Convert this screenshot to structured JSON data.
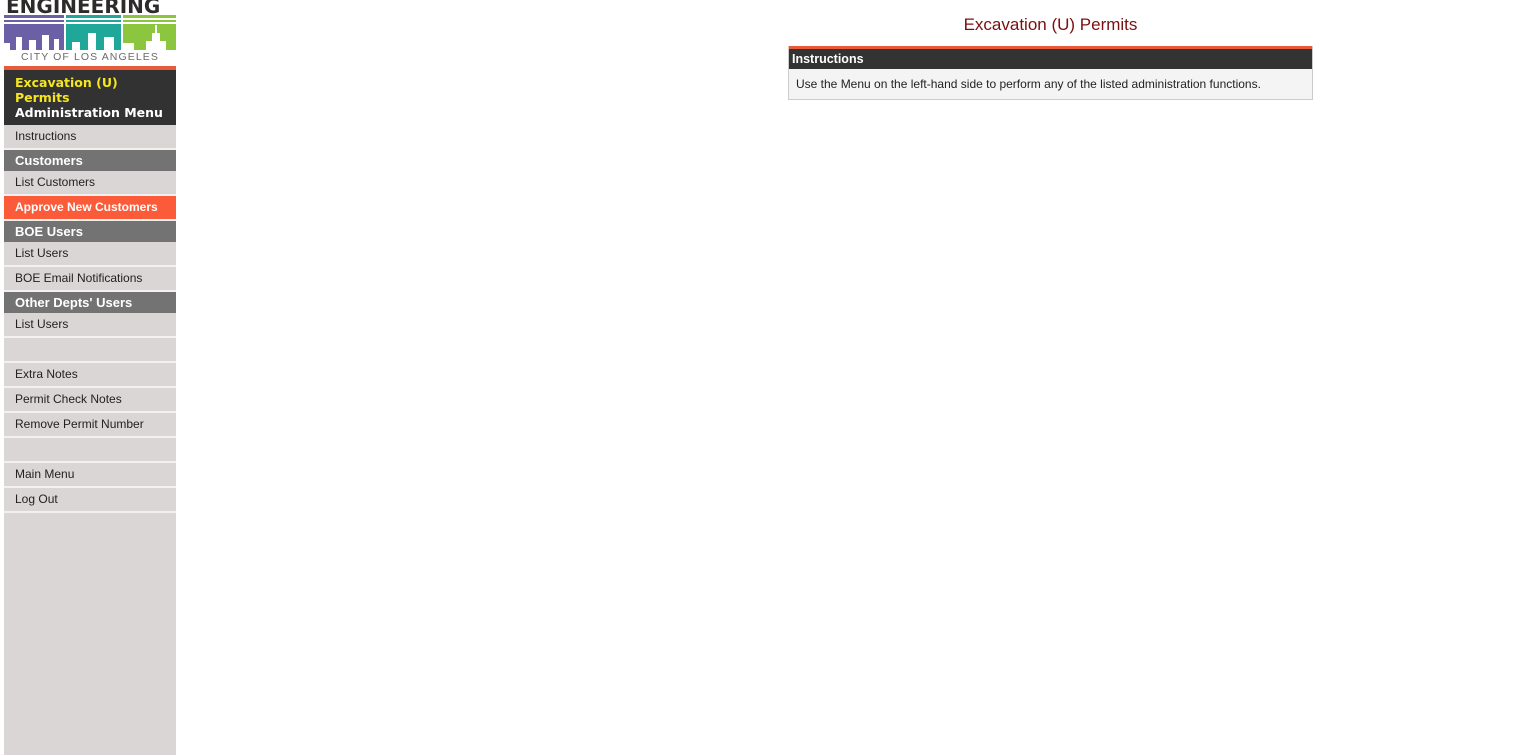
{
  "logo": {
    "top_text": "ENGINEERING",
    "bottom_text": "CITY OF LOS ANGELES",
    "colors": {
      "purple": "#6b5fa6",
      "teal": "#1fa89a",
      "green": "#8cc63f"
    }
  },
  "sidebar": {
    "title_line1": "Excavation (U) Permits",
    "title_line2": "Administration Menu",
    "items": [
      {
        "type": "item",
        "label": "Instructions"
      },
      {
        "type": "section",
        "label": "Customers"
      },
      {
        "type": "item",
        "label": "List Customers"
      },
      {
        "type": "item",
        "label": "Approve New Customers",
        "active": true
      },
      {
        "type": "section",
        "label": "BOE Users"
      },
      {
        "type": "item",
        "label": "List Users"
      },
      {
        "type": "item",
        "label": "BOE Email Notifications"
      },
      {
        "type": "section",
        "label": "Other Depts' Users"
      },
      {
        "type": "item",
        "label": "List Users"
      },
      {
        "type": "blank",
        "label": ""
      },
      {
        "type": "item",
        "label": "Extra Notes"
      },
      {
        "type": "item",
        "label": "Permit Check Notes"
      },
      {
        "type": "item",
        "label": "Remove Permit Number"
      },
      {
        "type": "blank",
        "label": ""
      },
      {
        "type": "item",
        "label": "Main Menu"
      },
      {
        "type": "item",
        "label": "Log Out"
      }
    ]
  },
  "main": {
    "title": "Excavation (U) Permits",
    "panel": {
      "heading": "Instructions",
      "text": "Use the Menu on the left-hand side to perform any of the listed administration functions."
    }
  },
  "colors": {
    "accent": "#e85a3c",
    "active_item": "#fc5b3a",
    "title_text": "#7a1010",
    "menu_title_yellow": "#f5e61f"
  }
}
